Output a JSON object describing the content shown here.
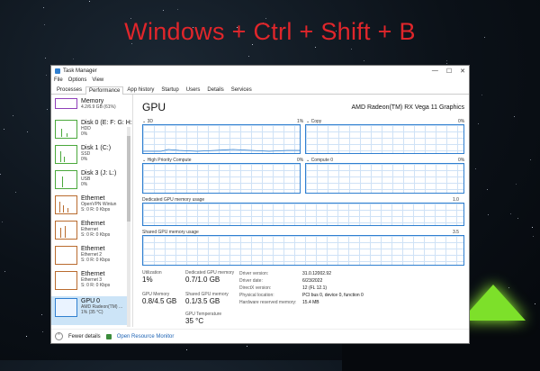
{
  "caption": "Windows + Ctrl + Shift + B",
  "window": {
    "title": "Task Manager",
    "menu": [
      "File",
      "Options",
      "View"
    ],
    "tabs": [
      "Processes",
      "Performance",
      "App history",
      "Startup",
      "Users",
      "Details",
      "Services"
    ],
    "active_tab": "Performance"
  },
  "sidebar": {
    "items": [
      {
        "name": "Memory",
        "sub1": "4.2/6.9 GB (61%)",
        "sub2": "",
        "sub3": "",
        "kind": "mem"
      },
      {
        "name": "Disk 0 (E: F: G: H:",
        "sub1": "HDD",
        "sub2": "0%",
        "sub3": "",
        "kind": "disk"
      },
      {
        "name": "Disk 1 (C:)",
        "sub1": "SSD",
        "sub2": "0%",
        "sub3": "",
        "kind": "disk"
      },
      {
        "name": "Disk 3 (J: L:)",
        "sub1": "USB",
        "sub2": "0%",
        "sub3": "",
        "kind": "disk"
      },
      {
        "name": "Ethernet",
        "sub1": "OpenVPN Wintun",
        "sub2": "S: 0 R: 0 Kbps",
        "sub3": "",
        "kind": "eth"
      },
      {
        "name": "Ethernet",
        "sub1": "Ethernet",
        "sub2": "S: 0 R: 0 Kbps",
        "sub3": "",
        "kind": "eth"
      },
      {
        "name": "Ethernet",
        "sub1": "Ethernet 2",
        "sub2": "S: 0 R: 0 Kbps",
        "sub3": "",
        "kind": "eth"
      },
      {
        "name": "Ethernet",
        "sub1": "Ethernet 3",
        "sub2": "S: 0 R: 0 Kbps",
        "sub3": "",
        "kind": "eth"
      },
      {
        "name": "GPU 0",
        "sub1": "AMD Radeon(TM) ...",
        "sub2": "1% (35 °C)",
        "sub3": "",
        "kind": "gpu"
      }
    ]
  },
  "gpu": {
    "title": "GPU",
    "model": "AMD Radeon(TM) RX Vega 11 Graphics",
    "engines": [
      {
        "name": "3D",
        "pct": "1%"
      },
      {
        "name": "Copy",
        "pct": "0%"
      },
      {
        "name": "High Priority Compute",
        "pct": "0%"
      },
      {
        "name": "Compute 0",
        "pct": "0%"
      }
    ],
    "dedicated_label": "Dedicated GPU memory usage",
    "dedicated_max": "1.0 GB",
    "shared_label": "Shared GPU memory usage",
    "shared_max": "3.5 GB",
    "stats": {
      "utilization_label": "Utilization",
      "utilization": "1%",
      "dedicated_label": "Dedicated GPU memory",
      "dedicated": "0.7/1.0 GB",
      "gpu_memory_label": "GPU Memory",
      "gpu_memory": "0.8/4.5 GB",
      "shared_label": "Shared GPU memory",
      "shared": "0.1/3.5 GB",
      "temp_label": "GPU Temperature",
      "temp": "35 °C"
    },
    "details": [
      {
        "k": "Driver version:",
        "v": "31.0.12002.92"
      },
      {
        "k": "Driver date:",
        "v": "6/23/2022"
      },
      {
        "k": "DirectX version:",
        "v": "12 (FL 12.1)"
      },
      {
        "k": "Physical location:",
        "v": "PCI bus 0, device 0, function 0"
      },
      {
        "k": "Hardware reserved memory:",
        "v": "15.4 MB"
      }
    ]
  },
  "bottom": {
    "fewer_details": "Fewer details",
    "open_monitor": "Open Resource Monitor"
  },
  "colors": {
    "caption": "#e0262b",
    "accent": "#2f7fd0",
    "disk": "#4aa83b",
    "memory": "#8e3fb8",
    "ethernet": "#b96b2e",
    "tent": "#7de02a"
  }
}
